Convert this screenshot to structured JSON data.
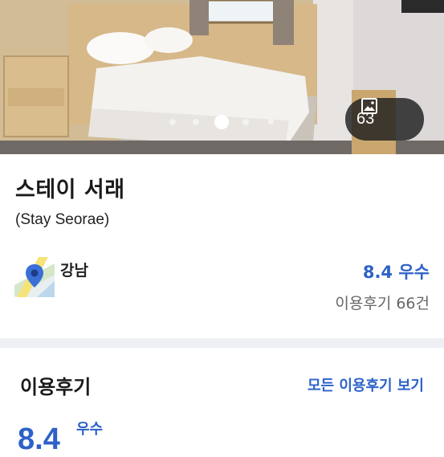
{
  "hero": {
    "photo_count": "63",
    "carousel": {
      "total": 5,
      "active_index": 2
    }
  },
  "listing": {
    "name": "스테이 서래",
    "name_en": "(Stay Seorae)",
    "area": "강남",
    "score": "8.4 우수",
    "review_count": "이용후기 66건"
  },
  "reviews": {
    "section_title": "이용후기",
    "see_all_label": "모든 이용후기 보기",
    "score": "8.4",
    "grade": "우수"
  },
  "colors": {
    "accent": "#2d62c8",
    "divider": "#eef0f3"
  }
}
